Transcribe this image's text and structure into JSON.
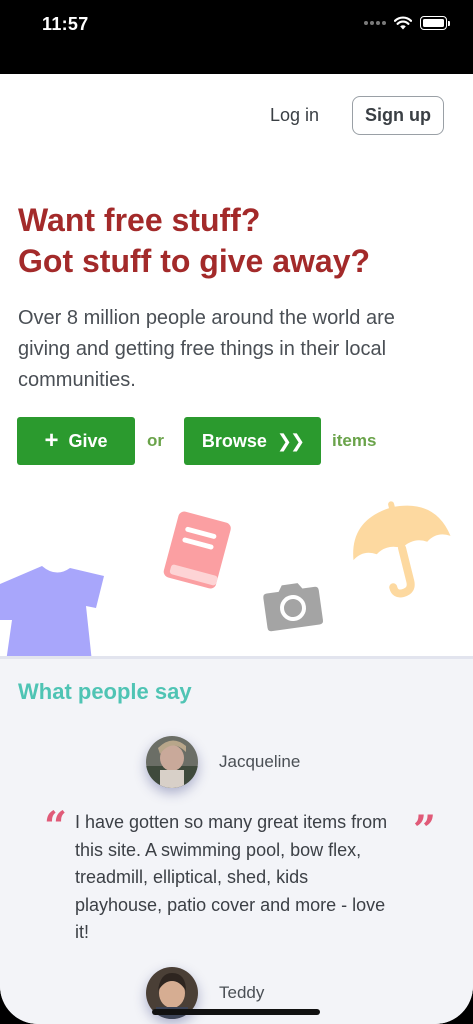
{
  "status_bar": {
    "time": "11:57"
  },
  "nav": {
    "login": "Log in",
    "signup": "Sign up"
  },
  "hero": {
    "title_line1": "Want free stuff?",
    "title_line2": "Got stuff to give away?",
    "description": "Over 8 million people around the world are giving and getting free things in their local communities."
  },
  "cta": {
    "give": "Give",
    "or": "or",
    "browse": "Browse",
    "items": "items"
  },
  "illustrations": [
    "shirt-icon",
    "book-icon",
    "camera-icon",
    "umbrella-icon"
  ],
  "colors": {
    "title": "#a32a2a",
    "button_green": "#2b9a2e",
    "secondary_green": "#6aa34a",
    "section_title": "#4fc4b4",
    "quote_mark": "#e05a78",
    "shirt": "#a8a6fb",
    "book": "#fb9fa2",
    "camera": "#a4a4a4",
    "umbrella": "#fdd9a0"
  },
  "testimonials": {
    "title": "What people say",
    "items": [
      {
        "name": "Jacqueline",
        "quote": "I have gotten so many great items from this site. A swimming pool, bow flex, treadmill, elliptical, shed, kids playhouse, patio cover and more - love it!"
      },
      {
        "name": "Teddy"
      }
    ]
  }
}
